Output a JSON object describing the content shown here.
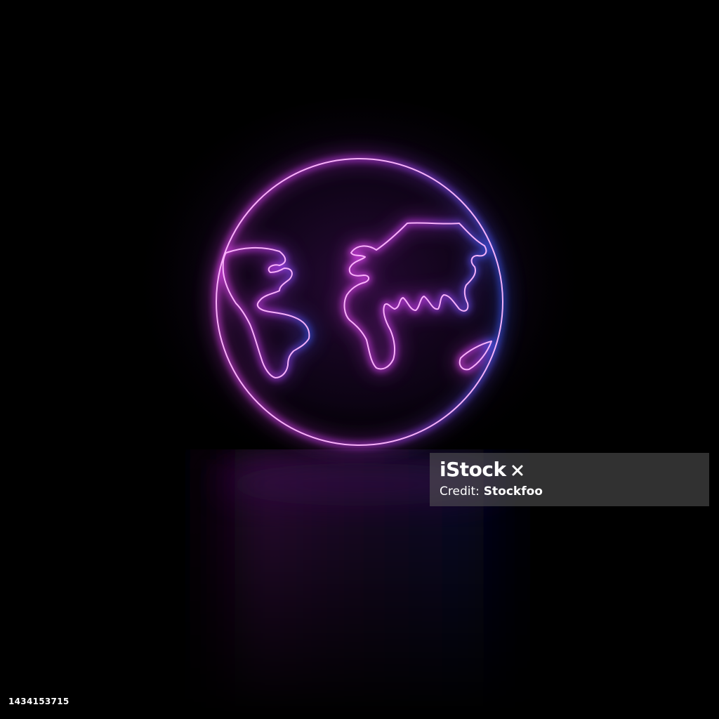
{
  "scene": {
    "subject": "globe-outline-icon",
    "background_color": "#000000",
    "colors": {
      "pink": "#e040ff",
      "magenta": "#c030f0",
      "violet": "#8a4cff",
      "blue": "#3d5cff",
      "glow_pink": "#ff3cff",
      "reflection": "#5a1a6a"
    }
  },
  "watermark": {
    "brand": "iStock",
    "credit_prefix": "Credit:",
    "credit_name": "Stockfoo"
  },
  "stock_id": "1434153715"
}
